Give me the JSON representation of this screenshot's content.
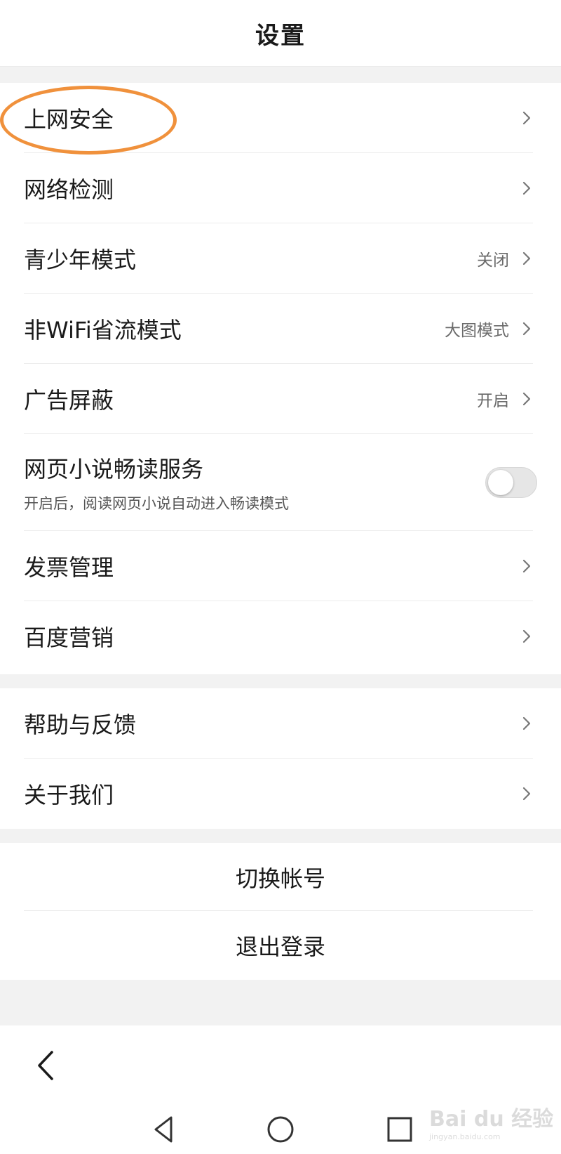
{
  "header": {
    "title": "设置"
  },
  "settings": [
    {
      "label": "上网安全",
      "value": ""
    },
    {
      "label": "网络检测",
      "value": ""
    },
    {
      "label": "青少年模式",
      "value": "关闭"
    },
    {
      "label": "非WiFi省流模式",
      "value": "大图模式"
    },
    {
      "label": "广告屏蔽",
      "value": "开启"
    },
    {
      "label": "网页小说畅读服务",
      "subtitle": "开启后，阅读网页小说自动进入畅读模式",
      "toggle_on": false
    },
    {
      "label": "发票管理",
      "value": ""
    },
    {
      "label": "百度营销",
      "value": ""
    }
  ],
  "help": [
    {
      "label": "帮助与反馈"
    },
    {
      "label": "关于我们"
    }
  ],
  "account": {
    "switch_label": "切换帐号",
    "logout_label": "退出登录"
  },
  "watermark": {
    "main": "Bai du 经验",
    "sub": "jingyan.baidu.com"
  },
  "colors": {
    "annotation": "#f0913c",
    "background": "#f2f2f2"
  }
}
